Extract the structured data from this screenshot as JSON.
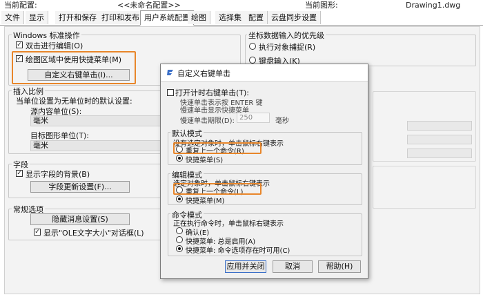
{
  "header": {
    "config_label": "当前配置:",
    "config_value": "<<未命名配置>>",
    "drawing_label": "当前图形:",
    "drawing_value": "Drawing1.dwg"
  },
  "tabs": [
    "文件",
    "显示",
    "打开和保存",
    "打印和发布",
    "用户系统配置",
    "绘图",
    "选择集",
    "配置",
    "云盘同步设置"
  ],
  "active_tab": "用户系统配置",
  "windows_group": {
    "title": "Windows 标准操作",
    "dblclick_edit": "双击进行编辑(O)",
    "dblclick_checked": true,
    "shortcut_menu": "绘图区域中使用快捷菜单(M)",
    "shortcut_checked": true,
    "customize_button": "自定义右键单击(I)..."
  },
  "insert_group": {
    "title": "插入比例",
    "desc": "当单位设置为无单位时的默认设置:",
    "source_label": "源内容单位(S):",
    "source_value": "毫米",
    "target_label": "目标图形单位(T):",
    "target_value": "毫米"
  },
  "field_group": {
    "title": "字段",
    "show_bg": "显示字段的背景(B)",
    "show_bg_checked": true,
    "update_button": "字段更新设置(F)..."
  },
  "general_group": {
    "title": "常规选项",
    "hidden_msg_button": "隐藏消息设置(S)",
    "ole_label": "显示\"OLE文字大小\"对话框(L)",
    "ole_checked": true
  },
  "coord_group": {
    "title": "坐标数据输入的优先级",
    "opt1": "执行对象捕捉(R)",
    "opt2": "键盘输入(K)"
  },
  "dialog": {
    "title": "自定义右键单击",
    "timed_check": "打开计时右键单击(T):",
    "timed_checked": false,
    "quick_click": "快速单击表示按 ENTER 键",
    "slow_click": "慢速单击显示快捷菜单",
    "slow_duration_label": "慢速单击期限(D):",
    "slow_duration_value": "250",
    "ms_unit": "毫秒",
    "default_mode": {
      "title": "默认模式",
      "desc": "没有选定对象时，单击鼠标右键表示",
      "opt_repeat": "重复上一个命令(R)",
      "opt_menu": "快捷菜单(S)",
      "selected": "menu"
    },
    "edit_mode": {
      "title": "编辑模式",
      "desc": "选定对象时，单击鼠标右键表示",
      "opt_repeat": "重复上一个命令(L)",
      "opt_menu": "快捷菜单(M)",
      "selected": "menu"
    },
    "command_mode": {
      "title": "命令模式",
      "desc": "正在执行命令时，单击鼠标右键表示",
      "opt_confirm": "确认(E)",
      "opt_menu_always": "快捷菜单: 总是启用(A)",
      "opt_menu_options": "快捷菜单: 命令选项存在时可用(C)",
      "selected": "menu_options"
    },
    "apply_button": "应用并关闭",
    "cancel_button": "取消",
    "help_button": "帮助(H)"
  },
  "colors": {
    "highlight": "#e8862a",
    "logo": "#3a6fc8"
  }
}
